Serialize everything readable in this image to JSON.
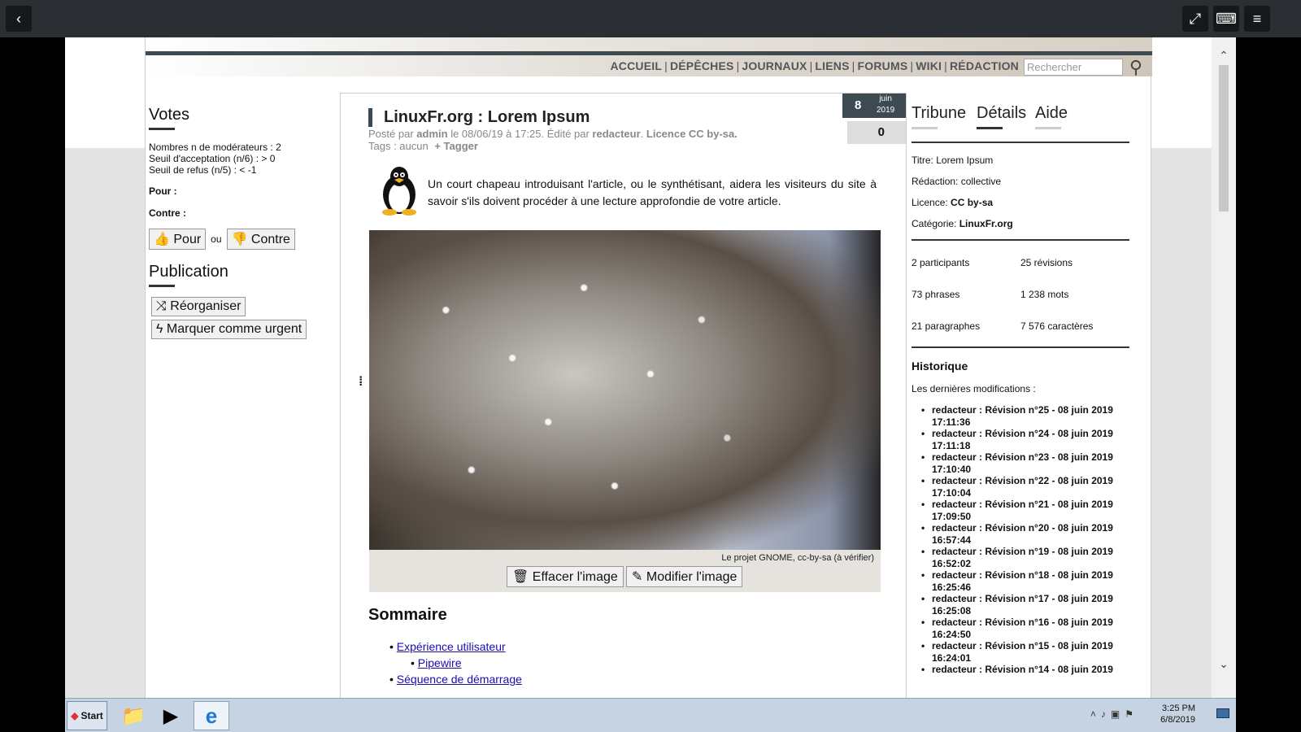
{
  "browser": {
    "back_label": "‹",
    "fullscreen_label": "⤢",
    "keyboard_label": "⌨",
    "menu_label": "≡"
  },
  "nav": {
    "items": [
      "ACCUEIL",
      "DÉPÊCHES",
      "JOURNAUX",
      "LIENS",
      "FORUMS",
      "WIKI",
      "RÉDACTION"
    ],
    "search_placeholder": "Rechercher"
  },
  "left": {
    "votes_title": "Votes",
    "votes_lines": [
      "Nombres n de modérateurs : 2",
      "Seuil d'acceptation (n/6) : > 0",
      "Seuil de refus (n/5) : < -1"
    ],
    "pour_label": "Pour :",
    "contre_label": "Contre :",
    "btn_pour": "Pour",
    "ou": "ou",
    "btn_contre": "Contre",
    "publication_title": "Publication",
    "btn_reorganiser": "Réorganiser",
    "btn_urgent": "Marquer comme urgent"
  },
  "article": {
    "title": "LinuxFr.org : Lorem Ipsum",
    "meta_prefix": "Posté par",
    "author": "admin",
    "meta_date": "le 08/06/19 à 17:25. Édité par",
    "editor": "redacteur",
    "license": "Licence CC by-sa.",
    "tags_label": "Tags : aucun",
    "tagger": "+ Tagger",
    "date_day": "8",
    "date_month": "juin",
    "date_year": "2019",
    "comments": "0",
    "chapeau": "Un court chapeau introduisant l'article, ou le synthétisant, aidera les visiteurs du site à savoir s'ils doivent procéder à une lecture approfondie de votre article.",
    "caption": "Le projet GNOME, cc-by-sa (à vérifier)",
    "btn_effacer": "Effacer l'image",
    "btn_modifier": "Modifier l'image",
    "sommaire_title": "Sommaire",
    "toc": [
      "Expérience utilisateur",
      "Pipewire",
      "Séquence de démarrage"
    ]
  },
  "right": {
    "tabs": [
      "Tribune",
      "Détails",
      "Aide"
    ],
    "titre_label": "Titre: Lorem Ipsum",
    "redaction_label": "Rédaction: collective",
    "licence_prefix": "Licence:",
    "licence_value": "CC by-sa",
    "categorie_prefix": "Catégorie:",
    "categorie_value": "LinuxFr.org",
    "stats": [
      "2 participants",
      "25 révisions",
      "73 phrases",
      "1 238 mots",
      "21 paragraphes",
      "7 576 caractères"
    ],
    "historique_title": "Historique",
    "historique_sub": "Les dernières modifications :",
    "revisions": [
      {
        "title": "redacteur : Révision n°25 - 08 juin 2019",
        "time": "17:11:36"
      },
      {
        "title": "redacteur : Révision n°24 - 08 juin 2019",
        "time": "17:11:18"
      },
      {
        "title": "redacteur : Révision n°23 - 08 juin 2019",
        "time": "17:10:40"
      },
      {
        "title": "redacteur : Révision n°22 - 08 juin 2019",
        "time": "17:10:04"
      },
      {
        "title": "redacteur : Révision n°21 - 08 juin 2019",
        "time": "17:09:50"
      },
      {
        "title": "redacteur : Révision n°20 - 08 juin 2019",
        "time": "16:57:44"
      },
      {
        "title": "redacteur : Révision n°19 - 08 juin 2019",
        "time": "16:52:02"
      },
      {
        "title": "redacteur : Révision n°18 - 08 juin 2019",
        "time": "16:25:46"
      },
      {
        "title": "redacteur : Révision n°17 - 08 juin 2019",
        "time": "16:25:08"
      },
      {
        "title": "redacteur : Révision n°16 - 08 juin 2019",
        "time": "16:24:50"
      },
      {
        "title": "redacteur : Révision n°15 - 08 juin 2019",
        "time": "16:24:01"
      },
      {
        "title": "redacteur : Révision n°14 - 08 juin 2019",
        "time": ""
      }
    ]
  },
  "taskbar": {
    "start_label": "Start",
    "time": "3:25 PM",
    "date": "6/8/2019"
  }
}
